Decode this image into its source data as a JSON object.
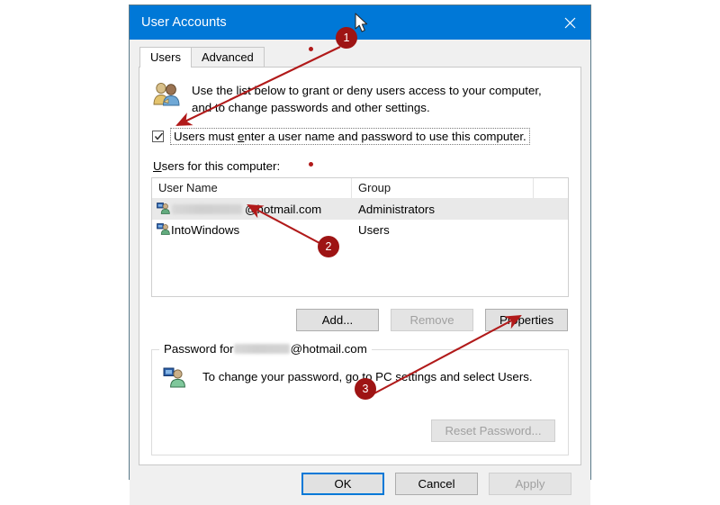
{
  "window": {
    "title": "User Accounts",
    "close_icon": "close-icon"
  },
  "tabs": [
    {
      "label": "Users",
      "active": true
    },
    {
      "label": "Advanced",
      "active": false
    }
  ],
  "intro": {
    "icon": "two-users-icon",
    "line1": "Use the list below to grant or deny users access to your computer,",
    "line2": "and to change passwords and other settings."
  },
  "checkbox": {
    "checked": true,
    "label_pre": "Users must ",
    "label_accel": "e",
    "label_post": "nter a user name and password to use this computer."
  },
  "list": {
    "label": "Users for this computer:",
    "columns": [
      "User Name",
      "Group"
    ],
    "rows": [
      {
        "icon": "user-account-icon",
        "user_redacted": true,
        "user_name": "@hotmail.com",
        "group": "Administrators",
        "selected": true
      },
      {
        "icon": "user-account-icon",
        "user_redacted": false,
        "user_name": "IntoWindows",
        "group": "Users",
        "selected": false
      }
    ]
  },
  "list_buttons": [
    {
      "label": "Add...",
      "disabled": false,
      "name": "add-button"
    },
    {
      "label": "Remove",
      "disabled": true,
      "name": "remove-button"
    },
    {
      "label": "Properties",
      "disabled": false,
      "name": "properties-button"
    }
  ],
  "password_group": {
    "legend_pre": "Password for ",
    "legend_redacted": true,
    "legend_post": "@hotmail.com",
    "icon": "user-password-icon",
    "text": "To change your password, go to PC settings and select Users.",
    "reset_button": {
      "label": "Reset Password...",
      "disabled": true
    }
  },
  "footer_buttons": [
    {
      "label": "OK",
      "disabled": false,
      "default": true,
      "name": "ok-button"
    },
    {
      "label": "Cancel",
      "disabled": false,
      "default": false,
      "name": "cancel-button"
    },
    {
      "label": "Apply",
      "disabled": true,
      "default": false,
      "name": "apply-button"
    }
  ],
  "annotations": [
    {
      "number": "1",
      "target": "users-must-enter-checkbox"
    },
    {
      "number": "2",
      "target": "user-row-intowindows"
    },
    {
      "number": "3",
      "target": "properties-button"
    }
  ],
  "colors": {
    "titlebar": "#0078d7",
    "annotation": "#9e1414",
    "arrow": "#b11a1a",
    "accent_focus": "#0078d7"
  }
}
